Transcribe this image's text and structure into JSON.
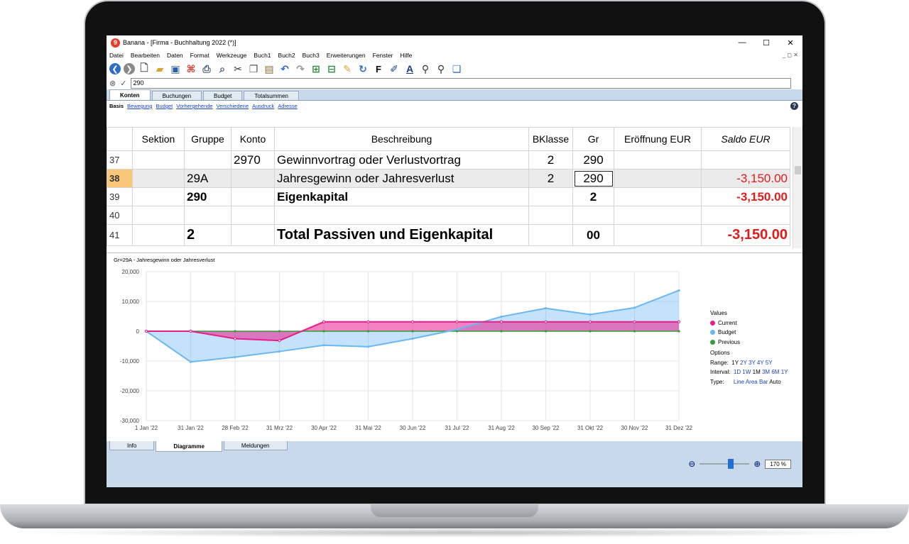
{
  "window": {
    "title": "Banana - [Firma - Buchhaltung 2022 (*)]",
    "controls": [
      "—",
      "☐",
      "✕"
    ],
    "mdi_controls": "_ ◻ ✕"
  },
  "menu": [
    "Datei",
    "Bearbeiten",
    "Daten",
    "Format",
    "Werkzeuge",
    "Buch1",
    "Buch2",
    "Buch3",
    "Erweiterungen",
    "Fenster",
    "Hilfe"
  ],
  "editbar": {
    "value": "290"
  },
  "tabs": [
    "Konten",
    "Buchungen",
    "Budget",
    "Totalsummen"
  ],
  "views": {
    "active": "Basis",
    "links": [
      "Bewegung",
      "Budget",
      "Vorhergehende",
      "Verschiedene",
      "Ausdruck",
      "Adresse"
    ]
  },
  "columns": [
    "",
    "Sektion",
    "Gruppe",
    "Konto",
    "Beschreibung",
    "BKlasse",
    "Gr",
    "Eröffnung EUR",
    "Saldo EUR"
  ],
  "rows": [
    {
      "num": "37",
      "sektion": "",
      "gruppe": "",
      "konto": "2970",
      "desc": "Gewinnvortrag oder Verlustvortrag",
      "bklasse": "2",
      "gr": "290",
      "eroeffnung": "",
      "saldo": ""
    },
    {
      "num": "38",
      "sektion": "",
      "gruppe": "29A",
      "konto": "",
      "desc": "Jahresgewinn oder Jahresverlust",
      "bklasse": "2",
      "gr": "290",
      "eroeffnung": "",
      "saldo": "-3,150.00"
    },
    {
      "num": "39",
      "sektion": "",
      "gruppe": "290",
      "konto": "",
      "desc": "Eigenkapital",
      "bklasse": "",
      "gr": "2",
      "eroeffnung": "",
      "saldo": "-3,150.00"
    },
    {
      "num": "40",
      "sektion": "",
      "gruppe": "",
      "konto": "",
      "desc": "",
      "bklasse": "",
      "gr": "",
      "eroeffnung": "",
      "saldo": ""
    },
    {
      "num": "41",
      "sektion": "",
      "gruppe": "2",
      "konto": "",
      "desc": "Total Passiven und Eigenkapital",
      "bklasse": "",
      "gr": "00",
      "eroeffnung": "",
      "saldo": "-3,150.00"
    }
  ],
  "chart_data": {
    "type": "area",
    "title": "Gr=29A - Jahresgewinn oder Jahresverlust",
    "categories": [
      "1 Jan '22",
      "31 Jan '22",
      "28 Feb '22",
      "31 Mrz '22",
      "30 Apr '22",
      "31 Mai '22",
      "30 Jun '22",
      "31 Jul '22",
      "31 Aug '22",
      "30 Sep '22",
      "31 Okt '22",
      "30 Nov '22",
      "31 Dez '22"
    ],
    "yticks": [
      "20,000",
      "10,000",
      "0",
      "-10,000",
      "-20,000",
      "-30,000"
    ],
    "ylim": [
      -30000,
      20000
    ],
    "series": [
      {
        "name": "Current",
        "color": "#e91e8c",
        "values": [
          0,
          0,
          -2500,
          -3150,
          3150,
          3150,
          3150,
          3150,
          3150,
          3150,
          3150,
          3150,
          3150
        ]
      },
      {
        "name": "Budget",
        "color": "#6bb7f2",
        "values": [
          0,
          -10300,
          -8700,
          -6800,
          -4700,
          -5200,
          -2500,
          600,
          4900,
          7700,
          5600,
          7900,
          13700
        ]
      },
      {
        "name": "Previous",
        "color": "#3a9a3a",
        "values": [
          0,
          0,
          0,
          0,
          0,
          0,
          0,
          0,
          0,
          0,
          0,
          0,
          0
        ]
      }
    ],
    "legend": {
      "values_label": "Values",
      "options_label": "Options",
      "range_label": "Range:",
      "range_options": [
        "1Y",
        "2Y",
        "3Y",
        "4Y",
        "5Y"
      ],
      "interval_label": "Interval:",
      "interval_options": [
        "1D",
        "1W",
        "1M",
        "3M",
        "6M",
        "1Y"
      ],
      "type_label": "Type:",
      "type_options": [
        "Line",
        "Area",
        "Bar",
        "Auto"
      ]
    }
  },
  "bottom_tabs": [
    "Info",
    "Diagramme",
    "Meldungen"
  ],
  "zoom": {
    "value": "170 %"
  }
}
